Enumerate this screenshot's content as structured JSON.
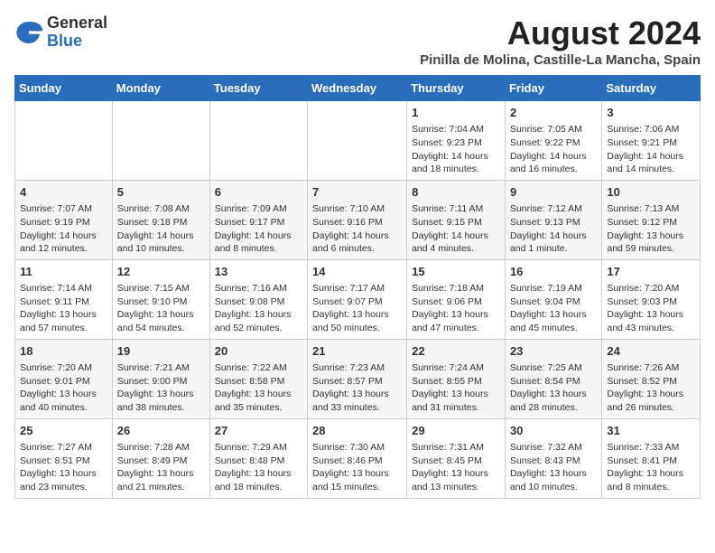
{
  "header": {
    "logo_general": "General",
    "logo_blue": "Blue",
    "title": "August 2024",
    "subtitle": "Pinilla de Molina, Castille-La Mancha, Spain"
  },
  "days_of_week": [
    "Sunday",
    "Monday",
    "Tuesday",
    "Wednesday",
    "Thursday",
    "Friday",
    "Saturday"
  ],
  "weeks": [
    [
      {
        "day": "",
        "info": ""
      },
      {
        "day": "",
        "info": ""
      },
      {
        "day": "",
        "info": ""
      },
      {
        "day": "",
        "info": ""
      },
      {
        "day": "1",
        "info": "Sunrise: 7:04 AM\nSunset: 9:23 PM\nDaylight: 14 hours and 18 minutes."
      },
      {
        "day": "2",
        "info": "Sunrise: 7:05 AM\nSunset: 9:22 PM\nDaylight: 14 hours and 16 minutes."
      },
      {
        "day": "3",
        "info": "Sunrise: 7:06 AM\nSunset: 9:21 PM\nDaylight: 14 hours and 14 minutes."
      }
    ],
    [
      {
        "day": "4",
        "info": "Sunrise: 7:07 AM\nSunset: 9:19 PM\nDaylight: 14 hours and 12 minutes."
      },
      {
        "day": "5",
        "info": "Sunrise: 7:08 AM\nSunset: 9:18 PM\nDaylight: 14 hours and 10 minutes."
      },
      {
        "day": "6",
        "info": "Sunrise: 7:09 AM\nSunset: 9:17 PM\nDaylight: 14 hours and 8 minutes."
      },
      {
        "day": "7",
        "info": "Sunrise: 7:10 AM\nSunset: 9:16 PM\nDaylight: 14 hours and 6 minutes."
      },
      {
        "day": "8",
        "info": "Sunrise: 7:11 AM\nSunset: 9:15 PM\nDaylight: 14 hours and 4 minutes."
      },
      {
        "day": "9",
        "info": "Sunrise: 7:12 AM\nSunset: 9:13 PM\nDaylight: 14 hours and 1 minute."
      },
      {
        "day": "10",
        "info": "Sunrise: 7:13 AM\nSunset: 9:12 PM\nDaylight: 13 hours and 59 minutes."
      }
    ],
    [
      {
        "day": "11",
        "info": "Sunrise: 7:14 AM\nSunset: 9:11 PM\nDaylight: 13 hours and 57 minutes."
      },
      {
        "day": "12",
        "info": "Sunrise: 7:15 AM\nSunset: 9:10 PM\nDaylight: 13 hours and 54 minutes."
      },
      {
        "day": "13",
        "info": "Sunrise: 7:16 AM\nSunset: 9:08 PM\nDaylight: 13 hours and 52 minutes."
      },
      {
        "day": "14",
        "info": "Sunrise: 7:17 AM\nSunset: 9:07 PM\nDaylight: 13 hours and 50 minutes."
      },
      {
        "day": "15",
        "info": "Sunrise: 7:18 AM\nSunset: 9:06 PM\nDaylight: 13 hours and 47 minutes."
      },
      {
        "day": "16",
        "info": "Sunrise: 7:19 AM\nSunset: 9:04 PM\nDaylight: 13 hours and 45 minutes."
      },
      {
        "day": "17",
        "info": "Sunrise: 7:20 AM\nSunset: 9:03 PM\nDaylight: 13 hours and 43 minutes."
      }
    ],
    [
      {
        "day": "18",
        "info": "Sunrise: 7:20 AM\nSunset: 9:01 PM\nDaylight: 13 hours and 40 minutes."
      },
      {
        "day": "19",
        "info": "Sunrise: 7:21 AM\nSunset: 9:00 PM\nDaylight: 13 hours and 38 minutes."
      },
      {
        "day": "20",
        "info": "Sunrise: 7:22 AM\nSunset: 8:58 PM\nDaylight: 13 hours and 35 minutes."
      },
      {
        "day": "21",
        "info": "Sunrise: 7:23 AM\nSunset: 8:57 PM\nDaylight: 13 hours and 33 minutes."
      },
      {
        "day": "22",
        "info": "Sunrise: 7:24 AM\nSunset: 8:55 PM\nDaylight: 13 hours and 31 minutes."
      },
      {
        "day": "23",
        "info": "Sunrise: 7:25 AM\nSunset: 8:54 PM\nDaylight: 13 hours and 28 minutes."
      },
      {
        "day": "24",
        "info": "Sunrise: 7:26 AM\nSunset: 8:52 PM\nDaylight: 13 hours and 26 minutes."
      }
    ],
    [
      {
        "day": "25",
        "info": "Sunrise: 7:27 AM\nSunset: 8:51 PM\nDaylight: 13 hours and 23 minutes."
      },
      {
        "day": "26",
        "info": "Sunrise: 7:28 AM\nSunset: 8:49 PM\nDaylight: 13 hours and 21 minutes."
      },
      {
        "day": "27",
        "info": "Sunrise: 7:29 AM\nSunset: 8:48 PM\nDaylight: 13 hours and 18 minutes."
      },
      {
        "day": "28",
        "info": "Sunrise: 7:30 AM\nSunset: 8:46 PM\nDaylight: 13 hours and 15 minutes."
      },
      {
        "day": "29",
        "info": "Sunrise: 7:31 AM\nSunset: 8:45 PM\nDaylight: 13 hours and 13 minutes."
      },
      {
        "day": "30",
        "info": "Sunrise: 7:32 AM\nSunset: 8:43 PM\nDaylight: 13 hours and 10 minutes."
      },
      {
        "day": "31",
        "info": "Sunrise: 7:33 AM\nSunset: 8:41 PM\nDaylight: 13 hours and 8 minutes."
      }
    ]
  ]
}
